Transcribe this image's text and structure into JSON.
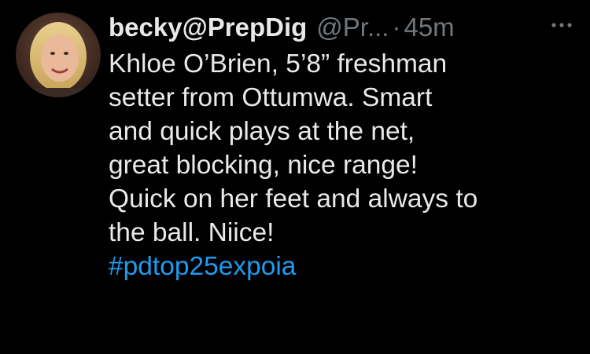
{
  "tweet": {
    "author": {
      "display_name": "becky@PrepDig",
      "handle": "@Pr...",
      "avatar_icon": "avatar-photo"
    },
    "separator": "·",
    "timestamp": "45m",
    "more_icon": "ellipsis-icon",
    "body_lines": [
      "Khloe O’Brien, 5’8” freshman",
      "setter from Ottumwa.  Smart",
      "and quick plays at the net,",
      "great blocking, nice range!",
      "Quick on her feet and always to",
      "the ball.  Niice!"
    ],
    "hashtag": "#pdtop25expoia"
  },
  "colors": {
    "background": "#000000",
    "primary_text": "#e7e9ea",
    "secondary_text": "#71767b",
    "link": "#1d9bf0"
  }
}
